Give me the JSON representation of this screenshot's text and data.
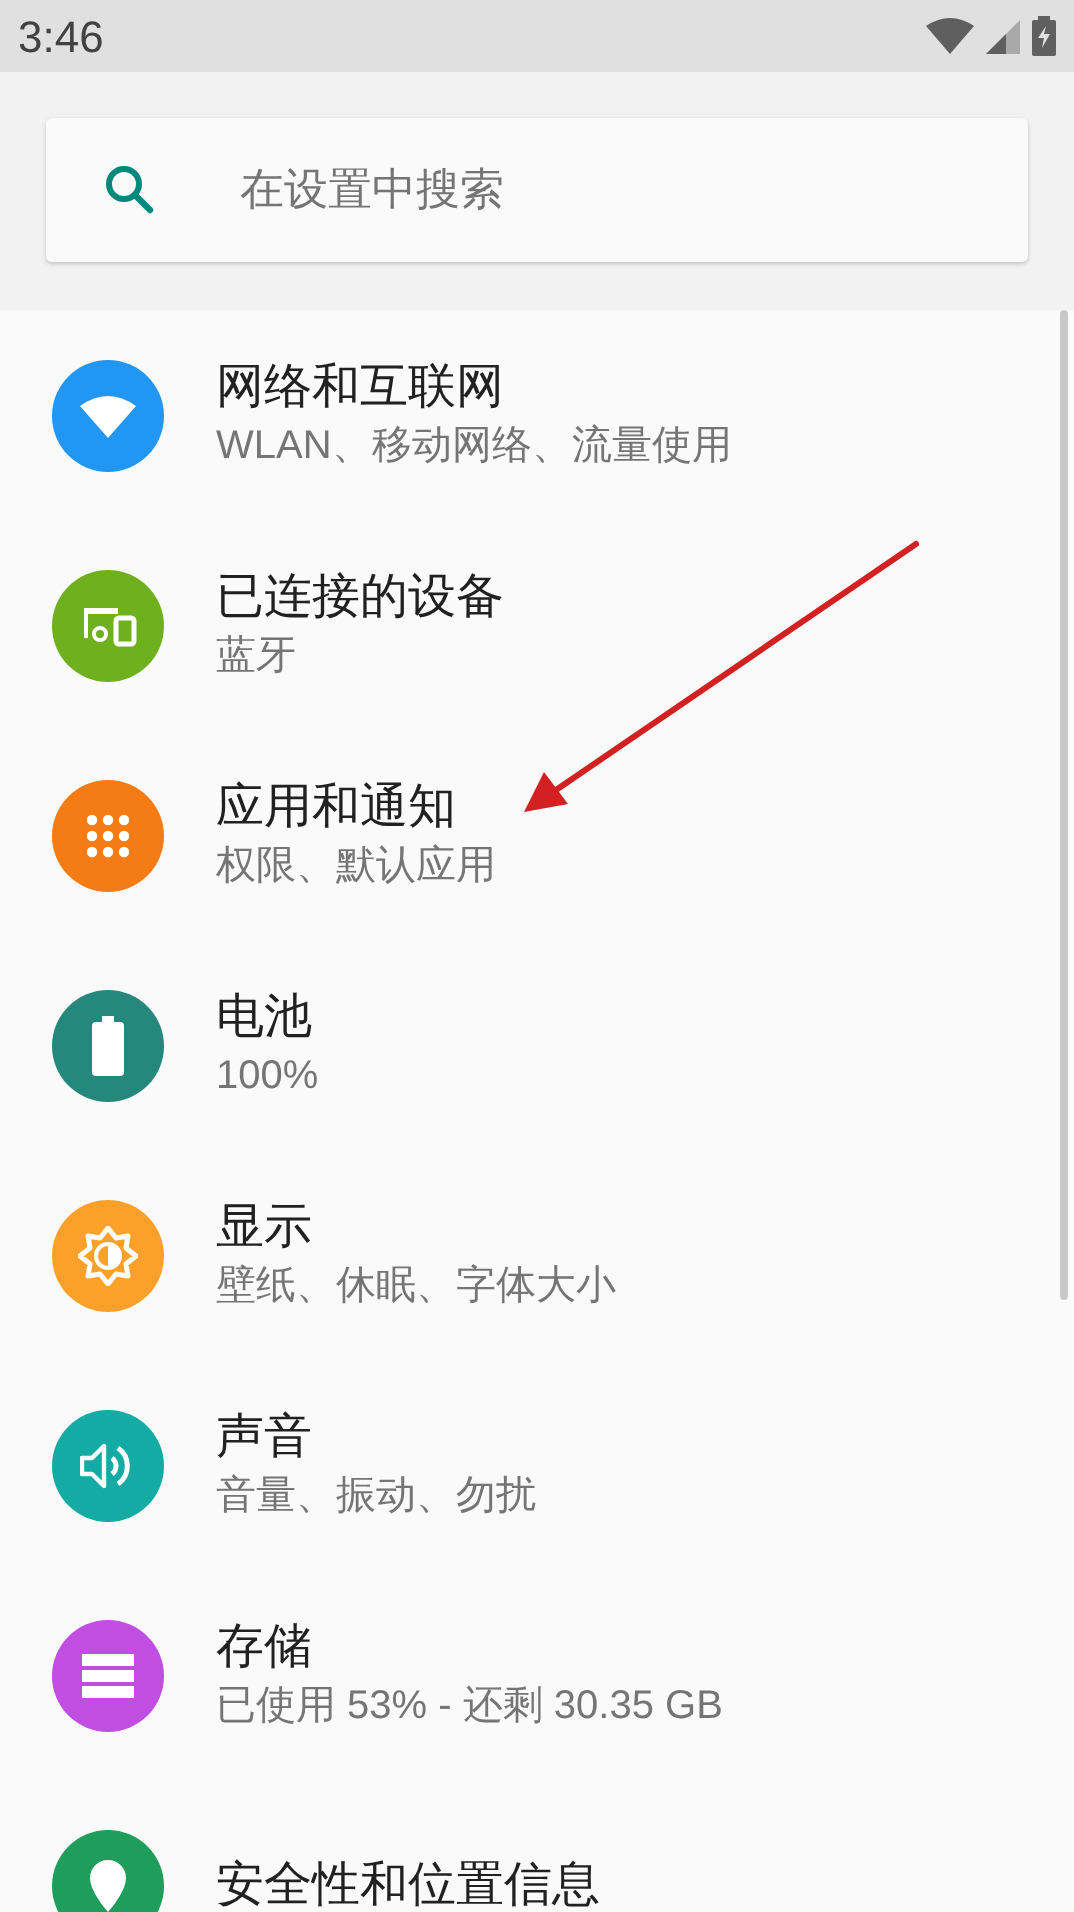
{
  "status_bar": {
    "time": "3:46"
  },
  "search": {
    "placeholder": "在设置中搜索"
  },
  "items": [
    {
      "kind": "wifi",
      "color": "#2196f3",
      "title": "网络和互联网",
      "subtitle": "WLAN、移动网络、流量使用"
    },
    {
      "kind": "devices",
      "color": "#6fb01e",
      "title": "已连接的设备",
      "subtitle": "蓝牙"
    },
    {
      "kind": "apps",
      "color": "#f57c15",
      "title": "应用和通知",
      "subtitle": "权限、默认应用"
    },
    {
      "kind": "battery",
      "color": "#26877c",
      "title": "电池",
      "subtitle": "100%"
    },
    {
      "kind": "display",
      "color": "#fba12a",
      "title": "显示",
      "subtitle": "壁纸、休眠、字体大小"
    },
    {
      "kind": "sound",
      "color": "#13aba3",
      "title": "声音",
      "subtitle": "音量、振动、勿扰"
    },
    {
      "kind": "storage",
      "color": "#c04ee0",
      "title": "存储",
      "subtitle": "已使用 53% - 还剩 30.35 GB"
    },
    {
      "kind": "location",
      "color": "#1e9e5a",
      "title": "安全性和位置信息"
    }
  ]
}
